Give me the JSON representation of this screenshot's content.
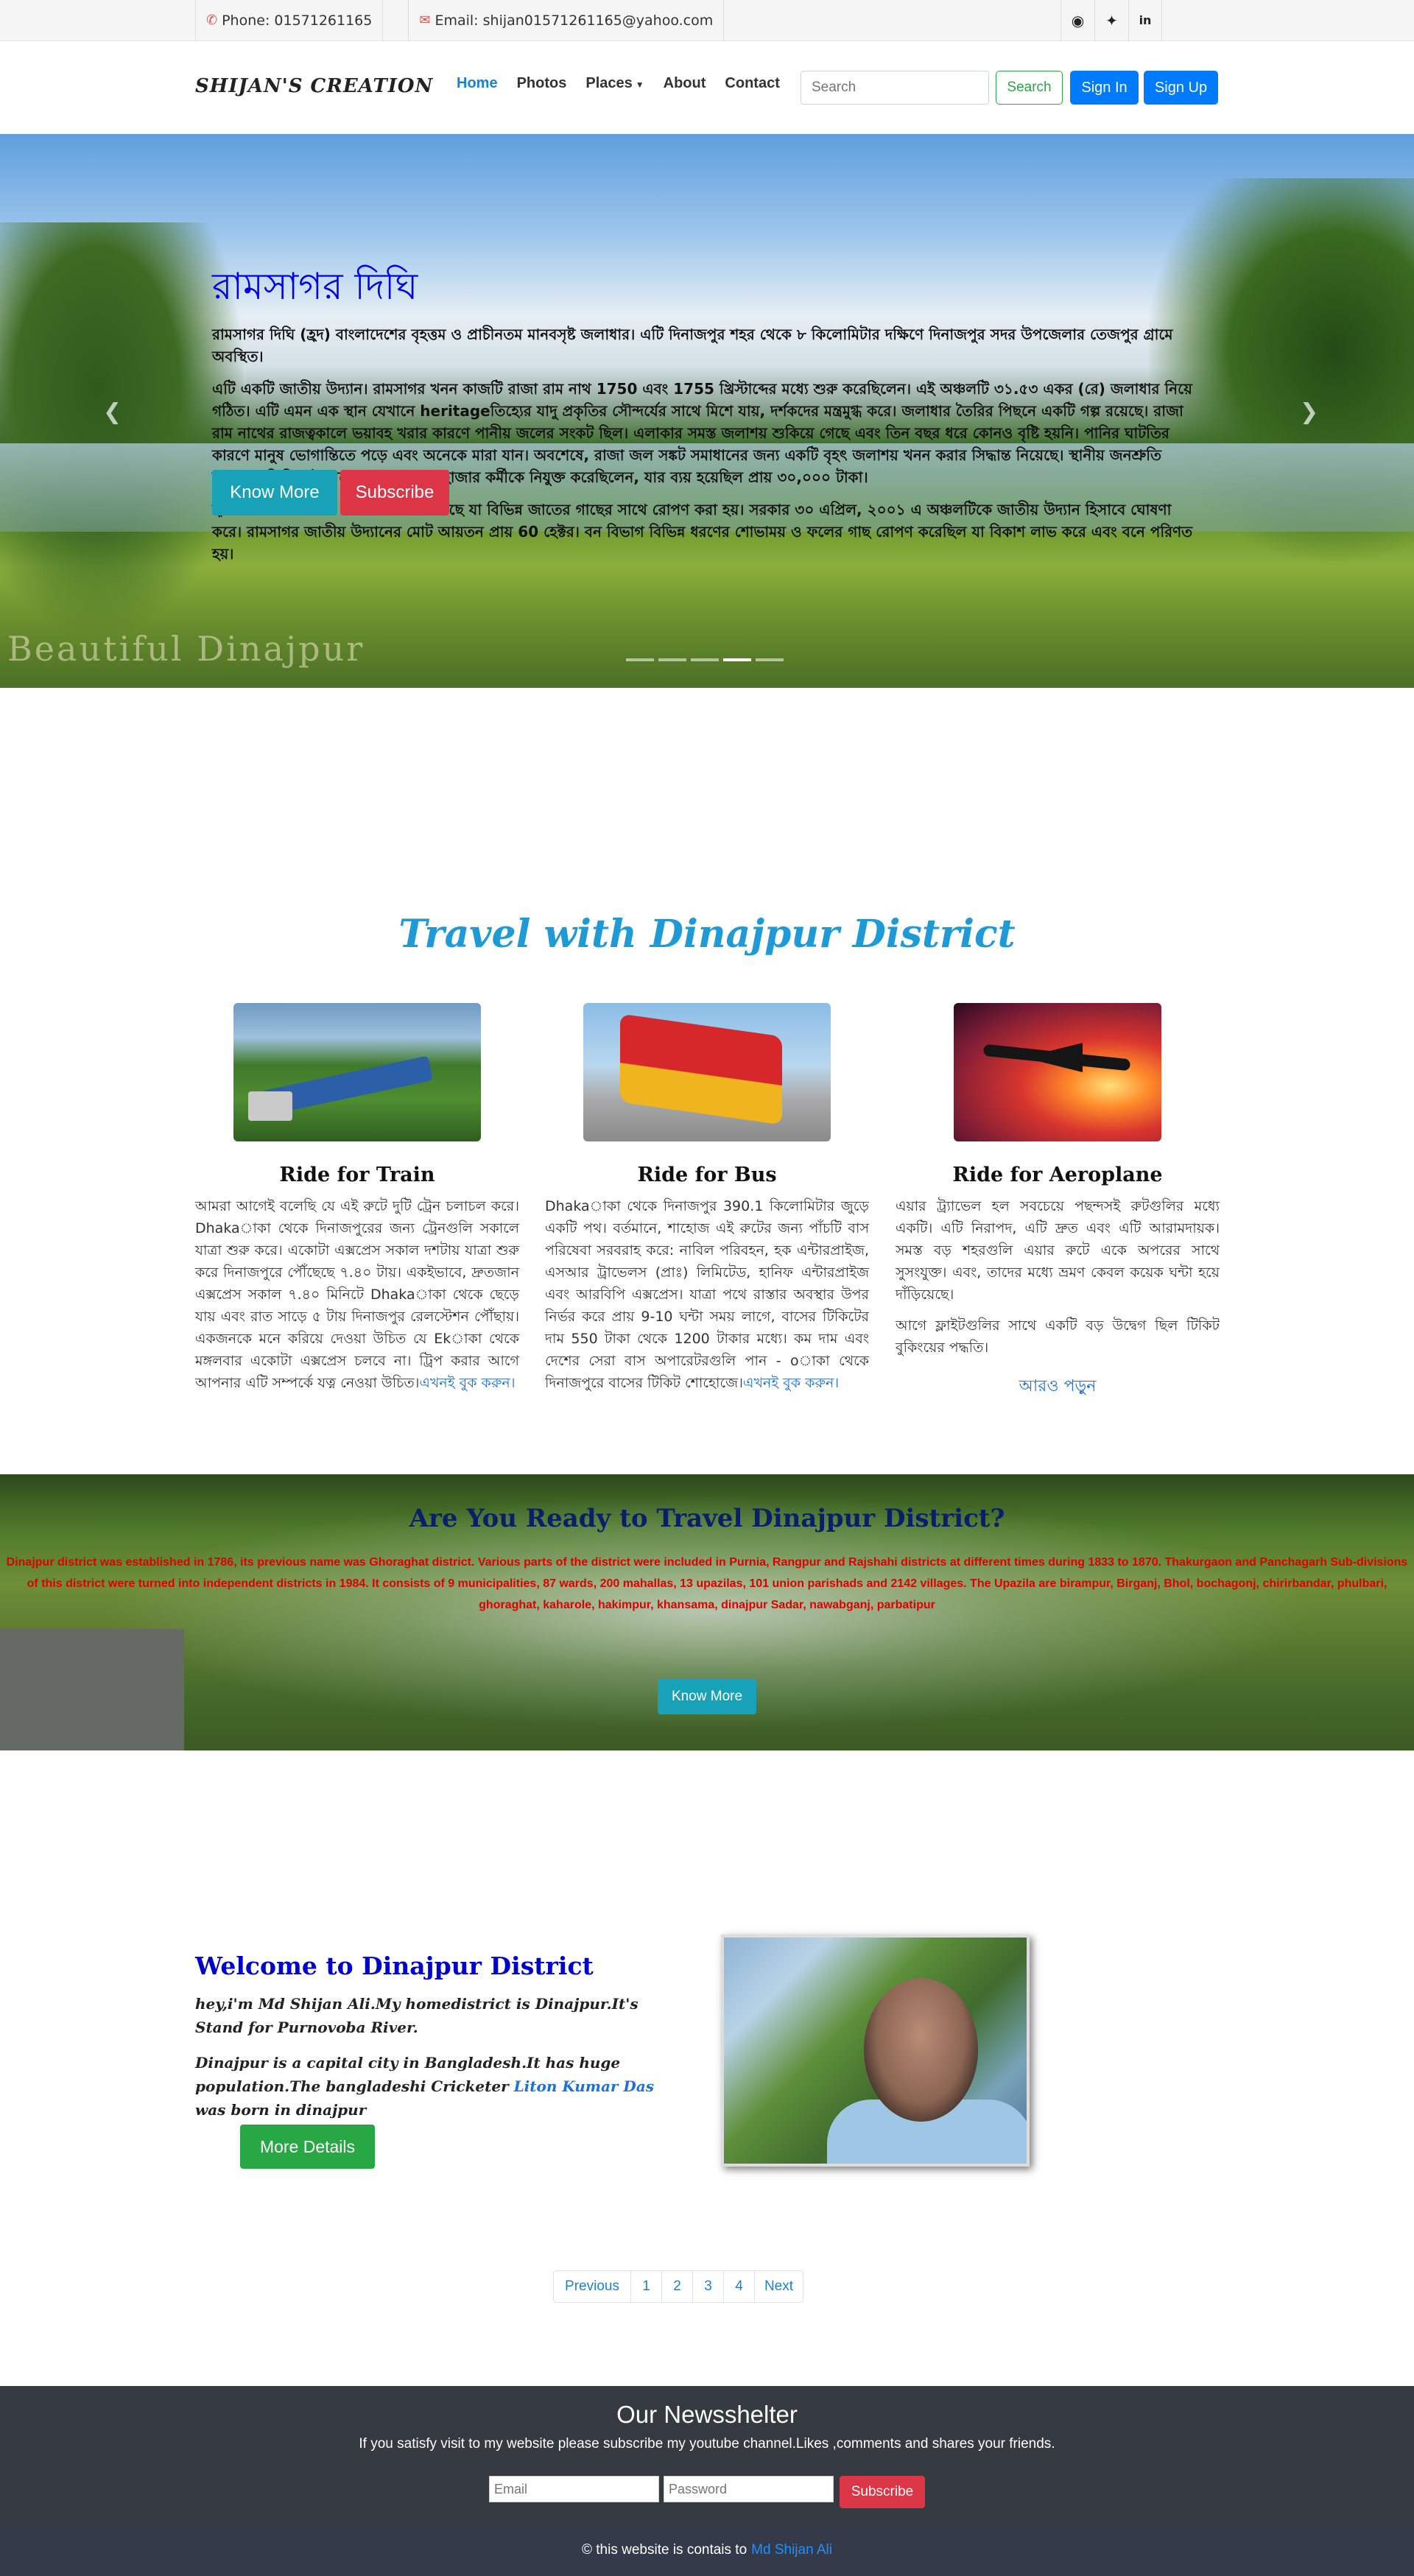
{
  "topbar": {
    "phone": "Phone: 01571261165",
    "email": "Email: shijan01571261165@yahoo.com",
    "social_icons": [
      "github-icon",
      "twitter-icon",
      "linkedin-icon"
    ]
  },
  "nav": {
    "brand": "SHIJAN'S CREATION",
    "links": [
      "Home",
      "Photos",
      "Places",
      "About",
      "Contact"
    ],
    "search_placeholder": "Search",
    "search_button": "Search",
    "sign_in": "Sign In",
    "sign_up": "Sign Up"
  },
  "hero": {
    "title": "রামসাগর দিঘি",
    "p1": "রামসাগর দিঘি (হ্রদ) বাংলাদেশের বৃহত্তম ও প্রাচীনতম মানবসৃষ্ট জলাধার। এটি দিনাজপুর শহর থেকে ৮ কিলোমিটার দক্ষিণে দিনাজপুর সদর উপজেলার তেজপুর গ্রামে অবস্থিত।",
    "p2": "এটি একটি জাতীয় উদ্যান। রামসাগর খনন কাজটি রাজা রাম নাথ 1750 এবং 1755 খ্রিস্টাব্দের মধ্যে শুরু করেছিলেন। এই অঞ্চলটি ৩১.৫৩ একর (রে) জলাধার নিয়ে গঠিত। এটি এমন এক স্থান যেখানে heritageতিহ্যের যাদু প্রকৃতির সৌন্দর্যের সাথে মিশে যায়, দর্শকদের মন্ত্রমুগ্ধ করে। জলাধার তৈরির পিছনে একটি গল্প রয়েছে। রাজা রাম নাথের রাজত্বকালে ভয়াবহ খরার কারণে পানীয় জলের সংকট ছিল। এলাকার সমস্ত জলাশয় শুকিয়ে গেছে এবং তিন বছর ধরে কোনও বৃষ্টি হয়নি। পানির ঘাটতির কারণে মানুষ ভোগান্তিতে পড়ে এবং অনেকে মারা যান। অবশেষে, রাজা জল সঙ্কট সমাধানের জন্য একটি বৃহৎ জলাশয় খনন করার সিদ্ধান্ত নিয়েছে। স্থানীয় জনশ্রুতি অনুসারে তিনি এই কাজের জন্য কয়েক হাজার কর্মীকে নিযুক্ত করেছিলেন, যার ব্যয় হয়েছিল প্রায় ৩০,০০০ টাকা।",
    "p3": "হ্রদের চারপাশে একটি আকর্ষণীয় বন রয়েছে যা বিভিন্ন জাতের গাছের সাথে রোপণ করা হয়। সরকার ৩০ এপ্রিল, ২০০১ এ অঞ্চলটিকে জাতীয় উদ্যান হিসাবে ঘোষণা করে। রামসাগর জাতীয় উদ্যানের মোট আয়তন প্রায় 60 হেক্টর। বন বিভাগ বিভিন্ন ধরণের শোভাময় ও ফলের গাছ রোপণ করেছিল যা বিকাশ লাভ করে এবং বনে পরিণত হয়।",
    "know_more": "Know More",
    "subscribe": "Subscribe",
    "watermark": "Beautiful Dinajpur"
  },
  "travel": {
    "title": "Travel with Dinajpur District",
    "cards": [
      {
        "title": "Ride for Train",
        "text": "আমরা আগেই বলেছি যে এই রুটে দুটি ট্রেন চলাচল করে। Dhakaাকা থেকে দিনাজপুরের জন্য ট্রেনগুলি সকালে যাত্রা শুরু করে। একোটা এক্সপ্রেস সকাল দশটায় যাত্রা শুরু করে দিনাজপুরে পৌঁছেছে ৭.৪০ টায়। একইভাবে, দ্রুতজান এক্সপ্রেস সকাল ৭.৪০ মিনিটে Dhakaাকা থেকে ছেড়ে যায় এবং রাত সাড়ে ৫ টায় দিনাজপুর রেলস্টেশন পৌঁছায়। একজনকে মনে করিয়ে দেওয়া উচিত যে Ekাকা থেকে মঙ্গলবার একোটা এক্সপ্রেস চলবে না। ট্রিপ করার আগে আপনার এটি সম্পর্কে যত্ন নেওয়া উচিত।",
        "link": "এখনই বুক করুন।"
      },
      {
        "title": "Ride for Bus",
        "text": "Dhakaাকা থেকে দিনাজপুর 390.1 কিলোমিটার জুড়ে একটি পথ। বর্তমানে, শাহোজ এই রুটের জন্য পাঁচটি বাস পরিষেবা সরবরাহ করে: নাবিল পরিবহন, হক এন্টারপ্রাইজ, এসআর ট্রাভেলস (প্রাঃ) লিমিটেড, হানিফ এন্টারপ্রাইজ এবং আরবিপি এক্সপ্রেস। যাত্রা পথে রাস্তার অবস্থার উপর নির্ভর করে প্রায় 9-10 ঘন্টা সময় লাগে, বাসের টিকিটের দাম 550 টাকা থেকে 1200 টাকার মধ্যে। কম দাম এবং দেশের সেরা বাস অপারেটরগুলি পান - oাকা থেকে দিনাজপুরে বাসের টিকিট শোহোজে।",
        "link": "এখনই বুক করুন।"
      },
      {
        "title": "Ride for Aeroplane",
        "text": "এয়ার ট্র্যাভেল হল সবচেয়ে পছন্দসই রুটগুলির মধ্যে একটি। এটি নিরাপদ, এটি দ্রুত এবং এটি আরামদায়ক। সমস্ত বড় শহরগুলি এয়ার রুটে একে অপরের সাথে সুসংযুক্ত। এবং, তাদের মধ্যে ভ্রমণ কেবল কয়েক ঘন্টা হয়ে দাঁড়িয়েছে।",
        "text2": "আগে ফ্লাইটগুলির সাথে একটি বড় উদ্বেগ ছিল টিকিট বুকিংয়ের পদ্ধতি।",
        "link": "আরও পড়ুন"
      }
    ]
  },
  "ready": {
    "title": "Are You Ready to Travel Dinajpur District?",
    "text": "Dinajpur district was established in 1786, its previous name was Ghoraghat district. Various parts of the district were included in Purnia, Rangpur and Rajshahi districts at different times during 1833 to 1870. Thakurgaon and Panchagarh Sub-divisions of this district were turned into independent districts in 1984. It consists of 9 municipalities, 87 wards, 200 mahallas, 13 upazilas, 101 union parishads and 2142 villages. The Upazila are birampur, Birganj, Bhol, bochagonj, chirirbandar, phulbari, ghoraghat, kaharole, hakimpur, khansama, dinajpur Sadar, nawabganj, parbatipur",
    "button": "Know More"
  },
  "welcome": {
    "title": "Welcome to Dinajpur District",
    "p1": "hey,i'm Md Shijan Ali.My homedistrict is Dinajpur.It's Stand for Purnovoba River.",
    "p2_before": "Dinajpur is a capital city in Bangladesh.It has huge population.The bangladeshi Cricketer ",
    "p2_link": "Liton Kumar Das",
    "p2_after": " was born in dinajpur",
    "button": "More Details"
  },
  "pagination": [
    "Previous",
    "1",
    "2",
    "3",
    "4",
    "Next"
  ],
  "footer": {
    "title": "Our Newsshelter",
    "text": "If you satisfy visit to my website please subscribe my youtube channel.Likes ,comments and shares your friends.",
    "email_placeholder": "Email",
    "password_placeholder": "Password",
    "subscribe": "Subscribe",
    "copy_text": "© this website is contais to",
    "copy_link": "Md Shijan Ali"
  }
}
